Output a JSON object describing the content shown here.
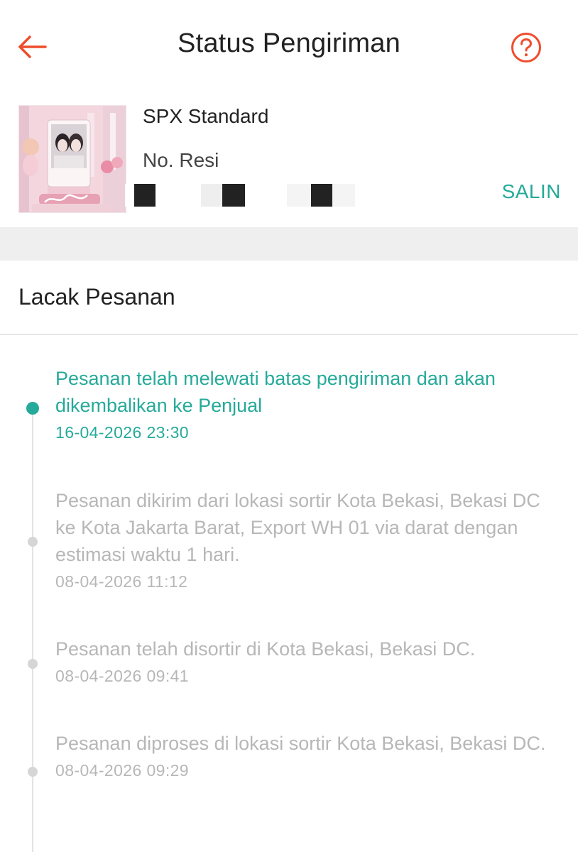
{
  "header": {
    "title": "Status Pengiriman",
    "back_icon": "arrow-left-icon",
    "help_icon": "question-circle-icon",
    "accent_color": "#ee4d2d"
  },
  "shipment": {
    "courier": "SPX Standard",
    "tracking_label": "No. Resi",
    "tracking_number_visible": false,
    "copy_label": "SALIN",
    "copy_color": "#26aa99",
    "thumbnail": "product-photo"
  },
  "tracking": {
    "title": "Lacak Pesanan",
    "active_color": "#26aa99",
    "inactive_color": "#b7b7b7",
    "events": [
      {
        "description": "Pesanan telah melewati batas pengiriman dan akan dikembalikan ke Penjual",
        "time": "16-04-2026 23:30",
        "status": "active"
      },
      {
        "description": "Pesanan dikirim dari lokasi sortir Kota Bekasi,  Bekasi DC ke Kota Jakarta Barat, Export WH 01 via darat dengan estimasi waktu 1 hari.",
        "time": "08-04-2026 11:12",
        "status": "past"
      },
      {
        "description": "Pesanan telah disortir di Kota Bekasi, Bekasi DC.",
        "time": "08-04-2026 09:41",
        "status": "past"
      },
      {
        "description": "Pesanan diproses di lokasi sortir Kota Bekasi, Bekasi DC.",
        "time": "08-04-2026 09:29",
        "status": "past"
      }
    ]
  }
}
